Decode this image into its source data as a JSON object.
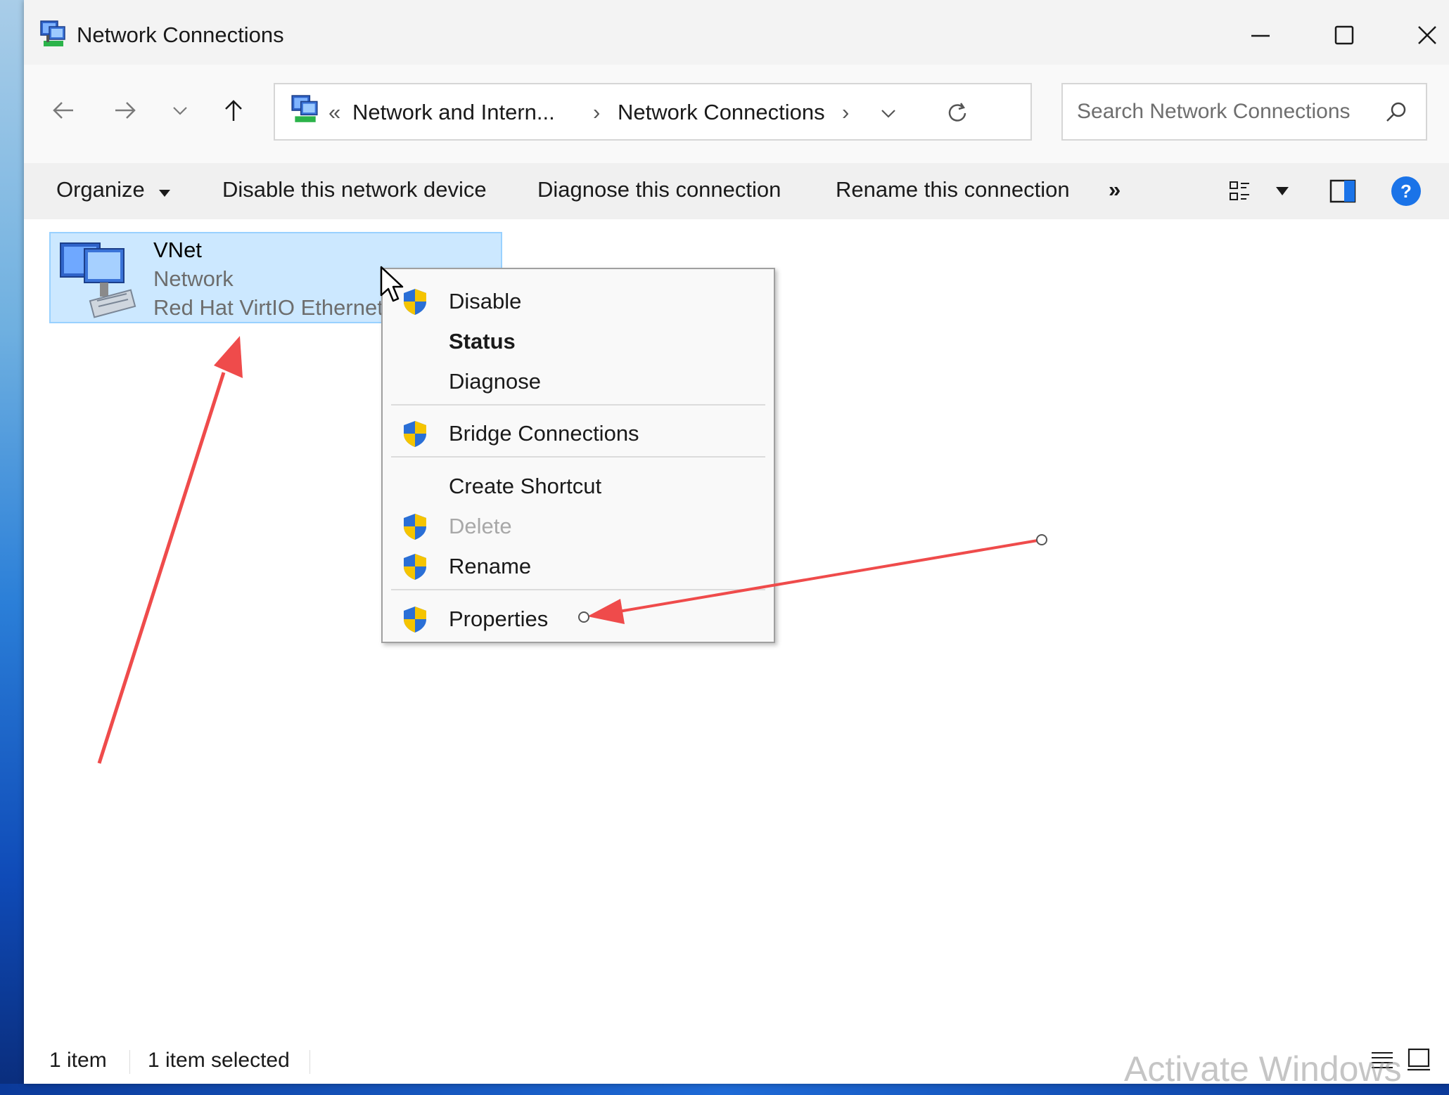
{
  "window": {
    "title": "Network Connections",
    "icons": {
      "app": "network-connections-icon",
      "minimize": "minimize-icon",
      "maximize": "maximize-icon",
      "close": "close-icon"
    }
  },
  "nav": {
    "icons": {
      "back": "back-arrow-icon",
      "forward": "forward-arrow-icon",
      "recent": "chevron-down-icon",
      "up": "up-arrow-icon"
    },
    "address": {
      "overflow": "«",
      "crumbs": [
        "Network and Intern...",
        "Network Connections"
      ],
      "separator": "›"
    },
    "search_placeholder": "Search Network Connections"
  },
  "commandbar": {
    "organize": "Organize",
    "disable": "Disable this network device",
    "diagnose": "Diagnose this connection",
    "rename": "Rename this connection",
    "more": "»"
  },
  "item": {
    "name": "VNet",
    "status": "Network",
    "device": "Red Hat VirtIO Ethernet"
  },
  "context_menu": {
    "disable": "Disable",
    "status": "Status",
    "diagnose": "Diagnose",
    "bridge": "Bridge Connections",
    "shortcut": "Create Shortcut",
    "delete": "Delete",
    "rename": "Rename",
    "properties": "Properties"
  },
  "statusbar": {
    "count": "1 item",
    "selected": "1 item selected"
  },
  "watermark": "Activate Windows",
  "colors": {
    "selection": "#cce8ff",
    "selection_border": "#99d1ff",
    "annotation_arrow": "#ef4b4b",
    "help": "#1a73e8",
    "shield_blue": "#2a6fd6",
    "shield_yellow": "#f5c400"
  }
}
